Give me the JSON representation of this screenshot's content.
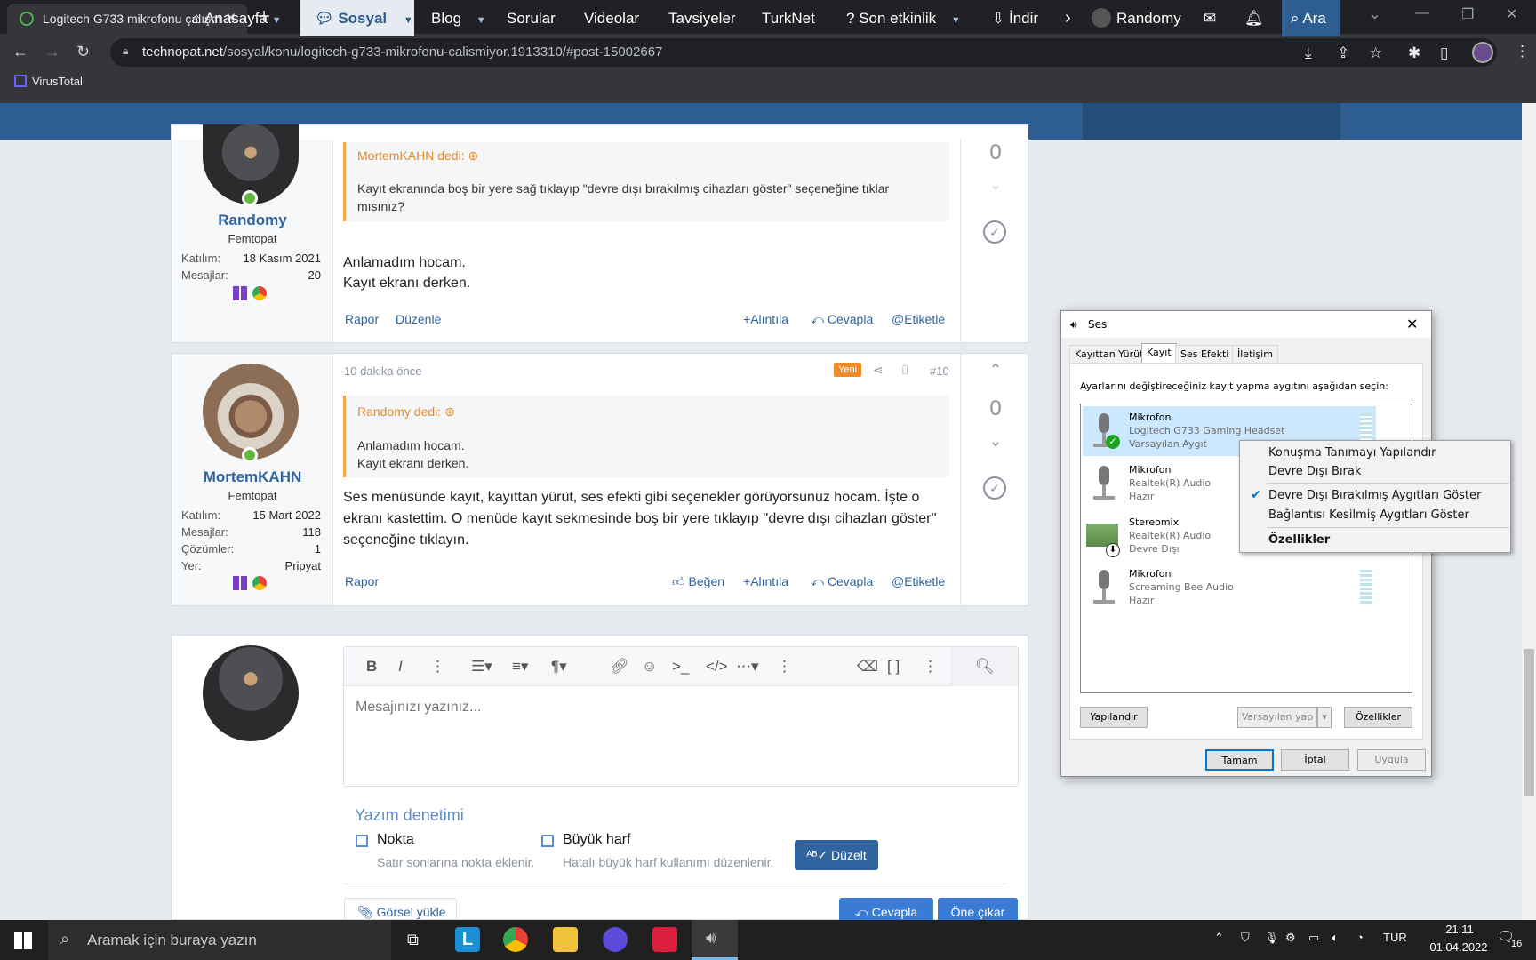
{
  "browser": {
    "tab_title": "Logitech G733 mikrofonu çalışmı",
    "url_host": "technopat.net",
    "url_path": "/sosyal/konu/logitech-g733-mikrofonu-calismiyor.1913310/#post-15002667",
    "bookmark": "VirusTotal"
  },
  "sitenav": {
    "items": [
      "Anasayfa",
      "Sosyal",
      "Blog",
      "Sorular",
      "Videolar",
      "Tavsiyeler",
      "TurkNet",
      "Son etkinlik",
      "İndir"
    ],
    "user": "Randomy",
    "search": "Ara"
  },
  "post1": {
    "username": "Randomy",
    "title": "Femtopat",
    "joined_label": "Katılım:",
    "joined": "18 Kasım 2021",
    "msgs_label": "Mesajlar:",
    "msgs": "20",
    "quote_author": "MortemKAHN dedi:",
    "quote_text": "Kayıt ekranında boş bir yere sağ tıklayıp \"devre dışı bırakılmış cihazları göster\" seçeneğine tıklar mısınız?",
    "line1": "Anlamadım hocam.",
    "line2": "Kayıt ekranı derken.",
    "votes": "0",
    "report": "Rapor",
    "edit": "Düzenle",
    "quote": "Alıntıla",
    "reply": "Cevapla",
    "tag": "Etiketle"
  },
  "post2": {
    "time": "10 dakika önce",
    "new_badge": "Yeni",
    "number": "#10",
    "username": "MortemKAHN",
    "title": "Femtopat",
    "joined_label": "Katılım:",
    "joined": "15 Mart 2022",
    "msgs_label": "Mesajlar:",
    "msgs": "118",
    "sol_label": "Çözümler:",
    "sol": "1",
    "loc_label": "Yer:",
    "loc": "Pripyat",
    "quote_author": "Randomy dedi:",
    "quote_line1": "Anlamadım hocam.",
    "quote_line2": "Kayıt ekranı derken.",
    "body": "Ses menüsünde kayıt, kayıttan yürüt, ses efekti gibi seçenekler görüyorsunuz hocam. İşte o ekranı kastettim. O menüde kayıt sekmesinde boş bir yere tıklayıp ''devre dışı cihazları göster'' seçeneğine tıklayın.",
    "votes": "0",
    "report": "Rapor",
    "like": "Beğen",
    "quote": "Alıntıla",
    "reply": "Cevapla",
    "tag": "Etiketle"
  },
  "editor": {
    "placeholder": "Mesajınızı yazınız...",
    "spell_title": "Yazım denetimi",
    "opt1": "Nokta",
    "opt1_desc": "Satır sonlarına nokta eklenir.",
    "opt2": "Büyük harf",
    "opt2_desc": "Hatalı büyük harf kullanımı düzenlenir.",
    "fix": "Düzelt",
    "upload": "Görsel yükle",
    "reply": "Cevapla",
    "preview": "Öne çıkar"
  },
  "dialog": {
    "title": "Ses",
    "tabs": [
      "Kayıttan Yürüt",
      "Kayıt",
      "Ses Efekti",
      "İletişim"
    ],
    "instruction": "Ayarlarını değiştireceğiniz kayıt yapma aygıtını aşağıdan seçin:",
    "devices": [
      {
        "name": "Mikrofon",
        "sub": "Logitech G733 Gaming Headset",
        "state": "Varsayılan Aygıt"
      },
      {
        "name": "Mikrofon",
        "sub": "Realtek(R) Audio",
        "state": "Hazır"
      },
      {
        "name": "Stereomix",
        "sub": "Realtek(R) Audio",
        "state": "Devre Dışı"
      },
      {
        "name": "Mikrofon",
        "sub": "Screaming Bee Audio",
        "state": "Hazır"
      }
    ],
    "configure": "Yapılandır",
    "set_default": "Varsayılan yap",
    "properties": "Özellikler",
    "ok": "Tamam",
    "cancel": "İptal",
    "apply": "Uygula"
  },
  "context_menu": {
    "items": [
      "Konuşma Tanımayı Yapılandır",
      "Devre Dışı Bırak",
      "Devre Dışı Bırakılmış Aygıtları Göster",
      "Bağlantısı Kesilmiş Aygıtları Göster",
      "Özellikler"
    ],
    "checked": "Devre Dışı Bırakılmış Aygıtları Göster"
  },
  "taskbar": {
    "search": "Aramak için buraya yazın",
    "lang": "TUR",
    "time": "21:11",
    "date": "01.04.2022",
    "notifications": "16"
  }
}
